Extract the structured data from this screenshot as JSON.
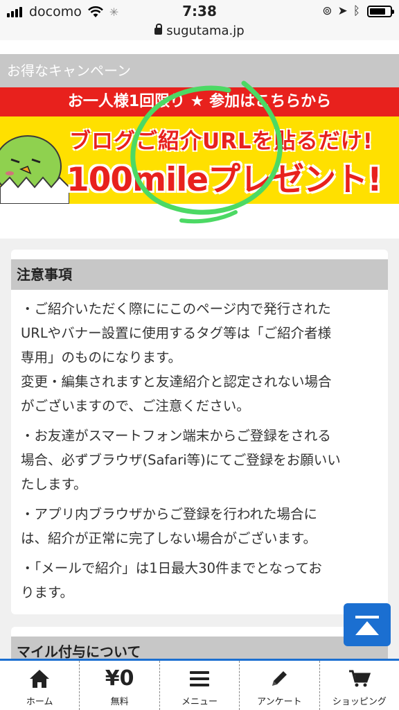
{
  "status_bar": {
    "carrier": "docomo",
    "time": "7:38"
  },
  "browser": {
    "url": "sugutama.jp"
  },
  "campaign": {
    "header": "お得なキャンペーン",
    "banner_top": "お一人様1回限り ★ 参加はこちらから",
    "banner_line1": "ブログご紹介URLを貼るだけ!",
    "banner_line2": "100mileプレゼント!",
    "colors": {
      "banner_red": "#e8211d",
      "banner_yellow": "#ffe000",
      "circle_green": "#4cd964"
    }
  },
  "notice": {
    "title": "注意事項",
    "paragraphs": [
      [
        "・ご紹介いただく際ににこのページ内で発行された",
        "URLやバナー設置に使用するタグ等は「ご紹介者様",
        "専用」のものになります。",
        "変更・編集されますと友達紹介と認定されない場合",
        "がございますので、ご注意ください。"
      ],
      [
        "・お友達がスマートフォン端末からご登録をされる",
        "場合、必ずブラウザ(Safari等)にてご登録をお願いい",
        "たします。"
      ],
      [
        "・アプリ内ブラウザからご登録を行われた場合に",
        "は、紹介が正常に完了しない場合がございます。"
      ],
      [
        "・「メールで紹介」は1日最大30件までとなってお",
        "ります。"
      ]
    ]
  },
  "mile_section": {
    "title": "マイル付与について"
  },
  "bottom_nav": {
    "items": [
      {
        "label": "ホーム",
        "icon": "home-icon"
      },
      {
        "label": "無料",
        "icon": "yen-icon",
        "glyph": "¥0"
      },
      {
        "label": "メニュー",
        "icon": "menu-icon"
      },
      {
        "label": "アンケート",
        "icon": "pencil-icon"
      },
      {
        "label": "ショッピング",
        "icon": "cart-icon"
      }
    ],
    "accent": "#1b6fd1"
  }
}
